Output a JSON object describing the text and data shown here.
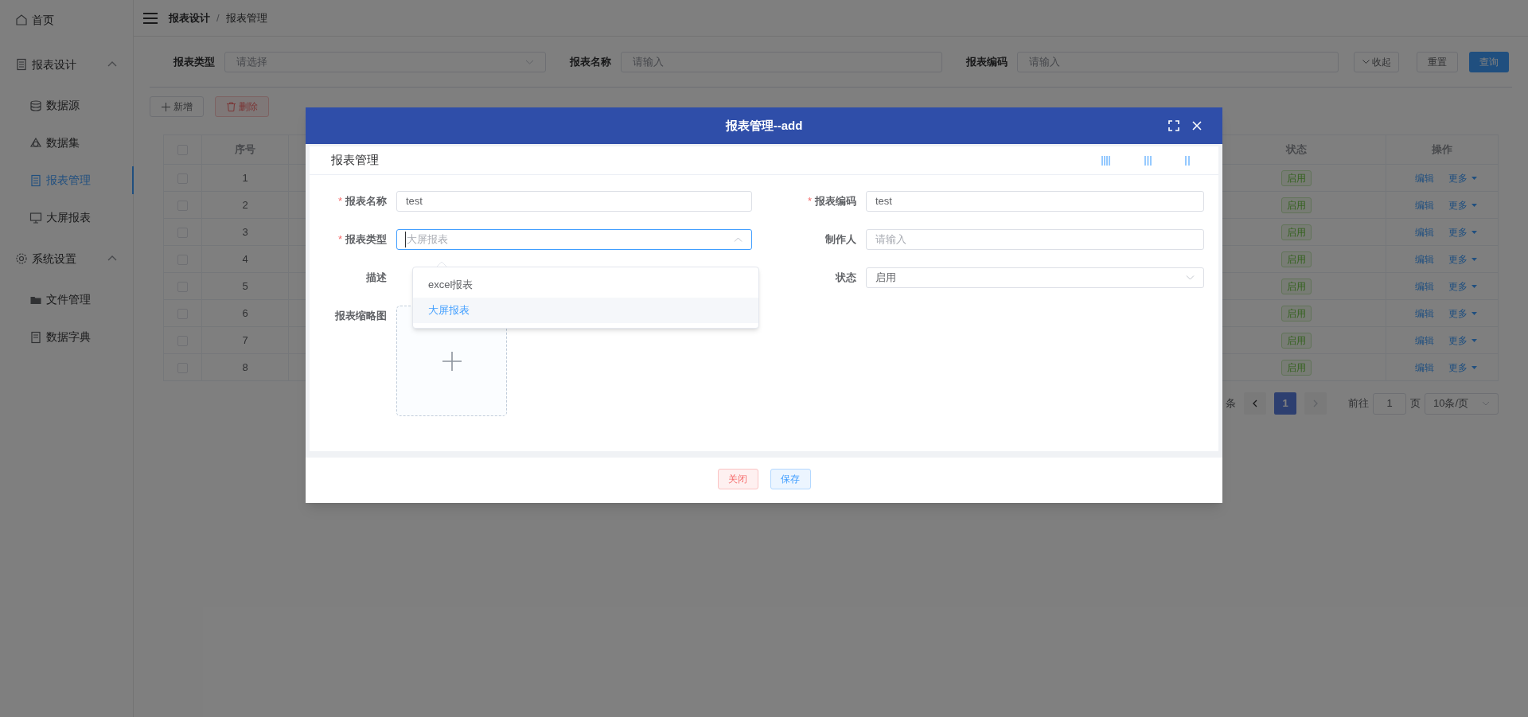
{
  "sidebar": {
    "items": [
      {
        "label": "首页",
        "selected": false
      },
      {
        "label": "报表设计",
        "selected": false,
        "expanded": true,
        "children": [
          {
            "label": "数据源",
            "selected": false
          },
          {
            "label": "数据集",
            "selected": false
          },
          {
            "label": "报表管理",
            "selected": true
          },
          {
            "label": "大屏报表",
            "selected": false
          }
        ]
      },
      {
        "label": "系统设置",
        "selected": false,
        "expanded": true,
        "children": [
          {
            "label": "文件管理",
            "selected": false
          },
          {
            "label": "数据字典",
            "selected": false
          }
        ]
      }
    ]
  },
  "breadcrumb": {
    "separator": "/",
    "items": [
      "报表设计",
      "报表管理"
    ]
  },
  "filters": [
    {
      "label": "报表类型",
      "placeholder": "请选择",
      "kind": "select"
    },
    {
      "label": "报表名称",
      "placeholder": "请输入",
      "kind": "input"
    },
    {
      "label": "报表编码",
      "placeholder": "请输入",
      "kind": "input"
    }
  ],
  "filter_buttons": [
    {
      "label": "收起",
      "kind": "collapse"
    },
    {
      "label": "重置",
      "kind": "default"
    },
    {
      "label": "查询",
      "kind": "primary"
    }
  ],
  "toolbar": [
    {
      "label": "新增",
      "kind": "add",
      "disabled": false
    },
    {
      "label": "删除",
      "kind": "delete",
      "disabled": true
    }
  ],
  "table": {
    "all_checked": false,
    "columns": [
      "序号",
      "状态",
      "操作"
    ],
    "rows": [
      {
        "index": "1",
        "checked": false,
        "status": "启用",
        "actions": [
          "编辑",
          "更多"
        ]
      },
      {
        "index": "2",
        "checked": false,
        "status": "启用",
        "actions": [
          "编辑",
          "更多"
        ]
      },
      {
        "index": "3",
        "checked": false,
        "status": "启用",
        "actions": [
          "编辑",
          "更多"
        ]
      },
      {
        "index": "4",
        "checked": false,
        "status": "启用",
        "actions": [
          "编辑",
          "更多"
        ]
      },
      {
        "index": "5",
        "checked": false,
        "status": "启用",
        "actions": [
          "编辑",
          "更多"
        ]
      },
      {
        "index": "6",
        "checked": false,
        "status": "启用",
        "actions": [
          "编辑",
          "更多"
        ]
      },
      {
        "index": "7",
        "checked": false,
        "status": "启用",
        "actions": [
          "编辑",
          "更多"
        ]
      },
      {
        "index": "8",
        "checked": false,
        "status": "启用",
        "actions": [
          "编辑",
          "更多"
        ]
      }
    ]
  },
  "pagination": {
    "total_suffix": "条",
    "current": "1",
    "goto_label": "前往",
    "goto_value": "1",
    "page_suffix": "页",
    "page_size": "10条/页"
  },
  "dialog": {
    "title": "报表管理--add",
    "card_title": "报表管理",
    "required_mark": "*",
    "fields": [
      {
        "label": "报表名称",
        "required": true,
        "kind": "input",
        "value": "test"
      },
      {
        "label": "报表编码",
        "required": true,
        "kind": "input",
        "value": "test"
      },
      {
        "label": "报表类型",
        "required": true,
        "kind": "select",
        "placeholder": "大屏报表"
      },
      {
        "label": "制作人",
        "required": false,
        "kind": "input",
        "placeholder": "请输入"
      },
      {
        "label": "描述",
        "required": false,
        "kind": "covered"
      },
      {
        "label": "状态",
        "required": false,
        "kind": "select",
        "value": "启用"
      }
    ],
    "dropdown": {
      "open": true,
      "options": [
        {
          "label": "excel报表",
          "selected": false
        },
        {
          "label": "大屏报表",
          "selected": true
        }
      ]
    },
    "upload_label": "报表缩略图",
    "buttons": [
      {
        "label": "关闭",
        "kind": "danger"
      },
      {
        "label": "保存",
        "kind": "primary"
      }
    ]
  }
}
